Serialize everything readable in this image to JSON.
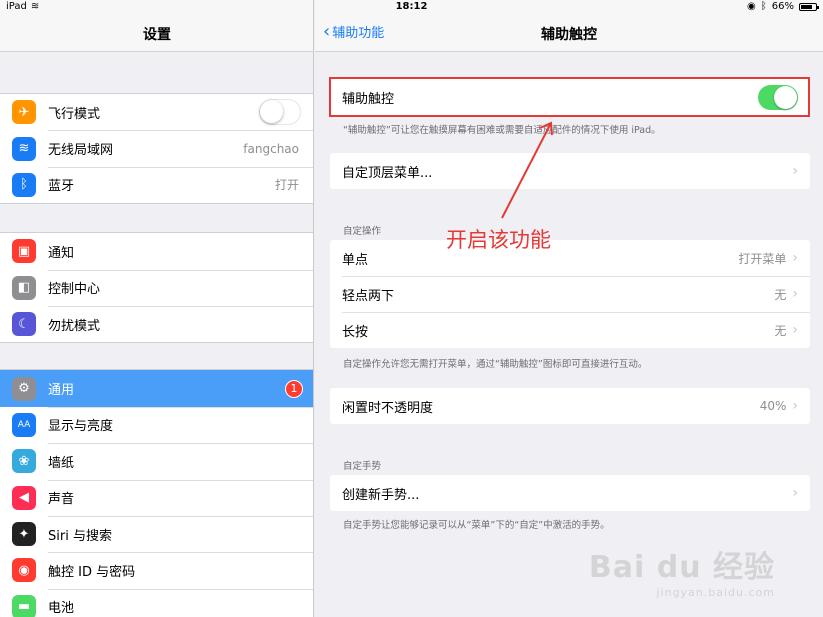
{
  "status": {
    "device": "iPad",
    "time": "18:12",
    "battery": "66%",
    "battery_level": 0.66
  },
  "left": {
    "title": "设置",
    "group1": [
      {
        "label": "飞行模式",
        "icon": "airplane-icon",
        "color": "#ff9500",
        "glyph": "✈",
        "type": "toggle",
        "value": ""
      },
      {
        "label": "无线局域网",
        "icon": "wifi-icon",
        "color": "#1a7cf5",
        "glyph": "≋",
        "type": "value",
        "value": "fangchao"
      },
      {
        "label": "蓝牙",
        "icon": "bluetooth-icon",
        "color": "#1a7cf5",
        "glyph": "ᛒ",
        "type": "value",
        "value": "打开"
      }
    ],
    "group2": [
      {
        "label": "通知",
        "icon": "notification-icon",
        "color": "#ff3b30",
        "glyph": "▣"
      },
      {
        "label": "控制中心",
        "icon": "control-center-icon",
        "color": "#8e8e93",
        "glyph": "◧"
      },
      {
        "label": "勿扰模式",
        "icon": "moon-icon",
        "color": "#5856d6",
        "glyph": "☾"
      }
    ],
    "group3": [
      {
        "label": "通用",
        "icon": "gear-icon",
        "color": "#8e8e93",
        "glyph": "⚙",
        "badge": "1"
      },
      {
        "label": "显示与亮度",
        "icon": "display-icon",
        "color": "#1a7cf5",
        "glyph": "AA"
      },
      {
        "label": "墙纸",
        "icon": "wallpaper-icon",
        "color": "#35aadc",
        "glyph": "❀"
      },
      {
        "label": "声音",
        "icon": "sound-icon",
        "color": "#ff2d55",
        "glyph": "◀"
      },
      {
        "label": "Siri 与搜索",
        "icon": "siri-icon",
        "color": "#222222",
        "glyph": "✦"
      },
      {
        "label": "触控 ID 与密码",
        "icon": "fingerprint-icon",
        "color": "#ff3b30",
        "glyph": "◉"
      },
      {
        "label": "电池",
        "icon": "battery-icon",
        "color": "#4cd964",
        "glyph": "▬"
      }
    ]
  },
  "right": {
    "back_label": "辅助功能",
    "title": "辅助触控",
    "assistive": {
      "label": "辅助触控",
      "enabled": true
    },
    "assistive_note": "“辅助触控”可让您在触摸屏幕有困难或需要自适应配件的情况下使用 iPad。",
    "top_menu": {
      "label": "自定顶层菜单..."
    },
    "custom_actions_header": "自定操作",
    "custom_actions": [
      {
        "label": "单点",
        "value": "打开菜单"
      },
      {
        "label": "轻点两下",
        "value": "无"
      },
      {
        "label": "长按",
        "value": "无"
      }
    ],
    "custom_actions_note": "自定操作允许您无需打开菜单，通过“辅助触控”图标即可直接进行互动。",
    "idle_opacity": {
      "label": "闲置时不透明度",
      "value": "40%"
    },
    "gestures_header": "自定手势",
    "new_gesture": {
      "label": "创建新手势..."
    },
    "gestures_note": "自定手势让您能够记录可以从“菜单”下的“自定”中激活的手势。"
  },
  "annotation": {
    "text": "开启该功能",
    "color": "#e53935"
  },
  "watermark": {
    "main": "Bai du 经验",
    "sub": "jingyan.baidu.com"
  }
}
